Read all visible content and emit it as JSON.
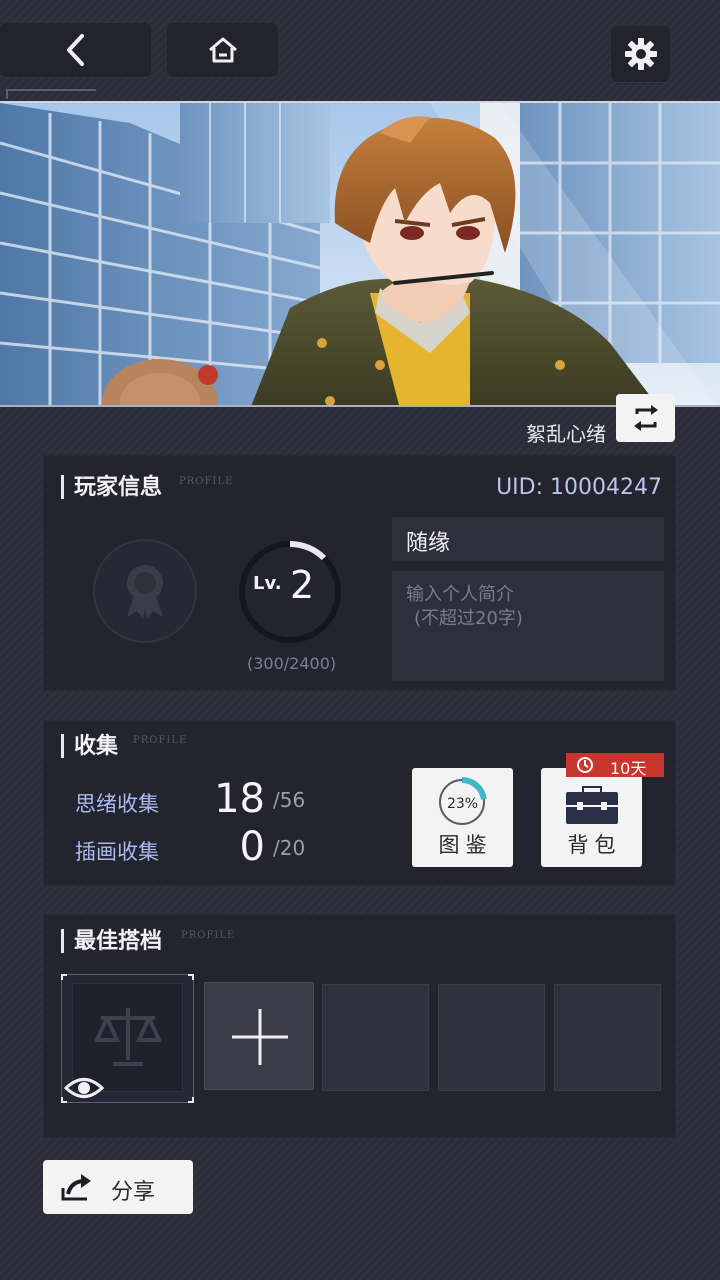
{
  "nav": {
    "back_icon": "back-arrow-icon",
    "home_icon": "home-icon",
    "settings_icon": "gear-icon"
  },
  "banner": {
    "background_name": "絮乱心绪",
    "swap_icon": "swap-icon"
  },
  "profile": {
    "title": "玩家信息",
    "subtitle": "PROFILE",
    "uid": "UID: 10004247",
    "level_prefix": "Lv.",
    "level": "2",
    "exp_text": "(300/2400)",
    "exp_fraction": 0.125,
    "nickname": "随缘",
    "bio_placeholder_line1": "输入个人简介",
    "bio_placeholder_line2": "(不超过20字)"
  },
  "collection": {
    "title": "收集",
    "subtitle": "PROFILE",
    "items": [
      {
        "label": "思绪收集",
        "value": "18",
        "total": "/56"
      },
      {
        "label": "插画收集",
        "value": "0",
        "total": "/20"
      }
    ],
    "atlas": {
      "label": "图鉴",
      "percent_text": "23%",
      "percent": 0.23
    },
    "bag": {
      "label": "背包",
      "timer": "10天"
    }
  },
  "partners": {
    "title": "最佳搭档",
    "subtitle": "PROFILE"
  },
  "share": {
    "label": "分享"
  },
  "colors": {
    "accent": "#b8c6ee",
    "ring_teal": "#3fb8c4",
    "tag_red": "#c9362d"
  }
}
